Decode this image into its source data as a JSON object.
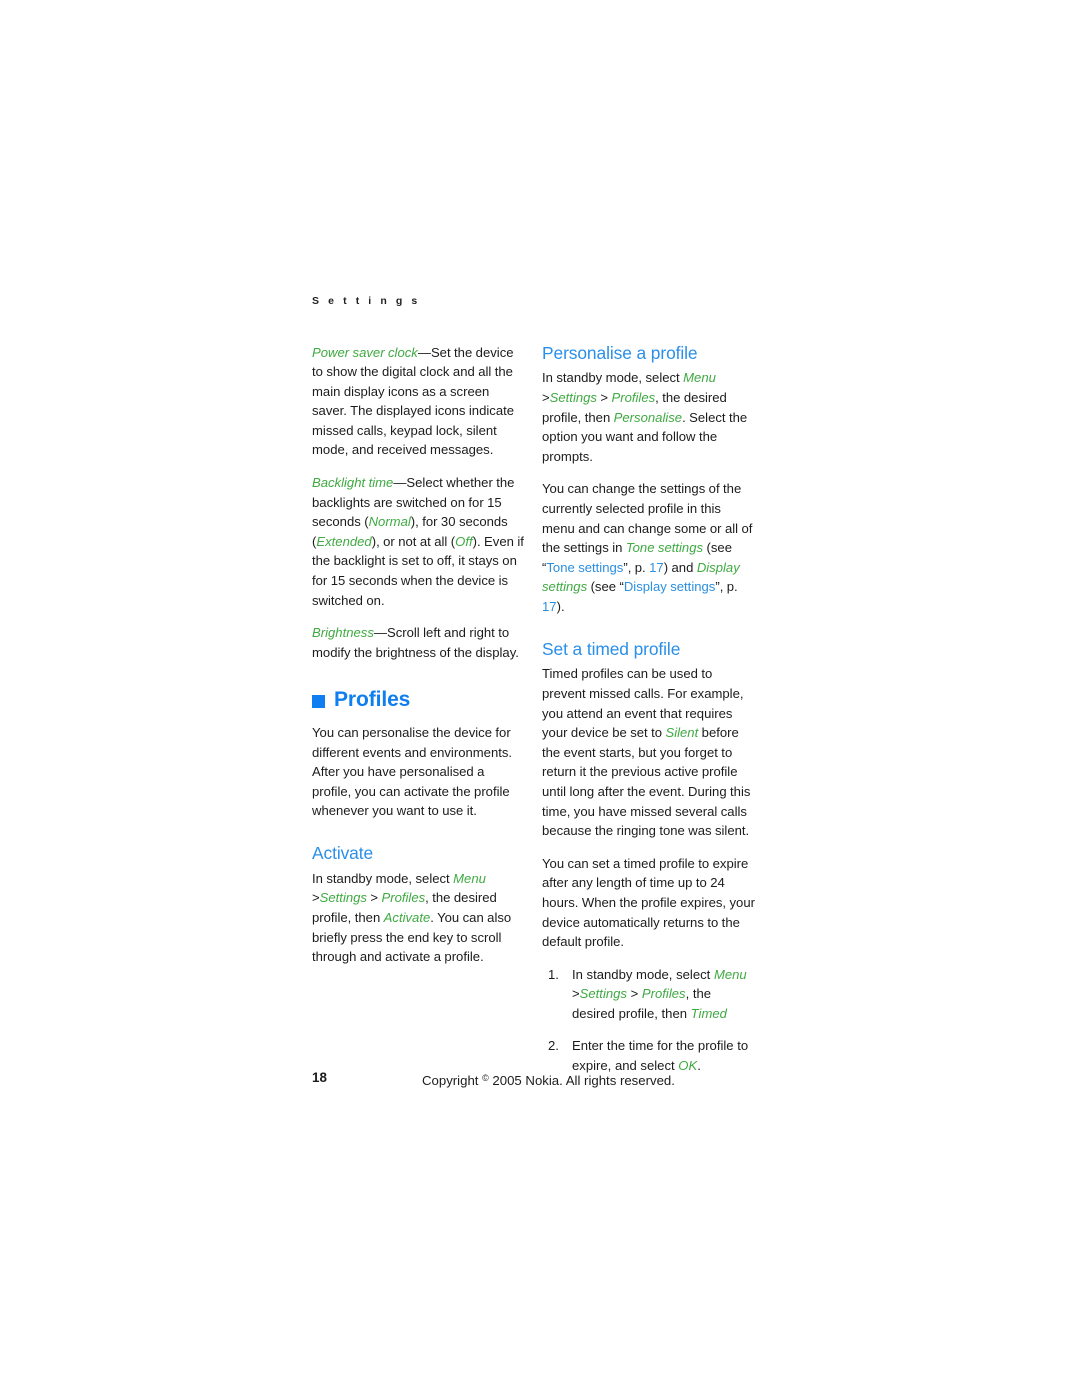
{
  "running_head": "S e t t i n g s",
  "colors": {
    "chapter_blue": "#0f7ef0",
    "section_blue": "#2a8fe8",
    "menu_green": "#3faa42",
    "link_blue": "#2b8fe0",
    "body_text": "#1c1c1c",
    "page_background": "#ffffff"
  },
  "left_column": {
    "power_saver": {
      "term": "Power saver clock",
      "dash": "—Set the device to show the digital clock and all the main display icons as a screen saver. The displayed icons indicate missed calls, keypad lock, silent mode, and received messages."
    },
    "backlight": {
      "term": "Backlight time",
      "t1": "—Select whether the backlights are switched on for 15 seconds (",
      "normal": "Normal",
      "t2": "), for 30 seconds (",
      "extended": "Extended",
      "t3": "), or not at all (",
      "off": "Off",
      "t4": "). Even if the backlight is set to off, it stays on for 15 seconds when the device is switched on."
    },
    "brightness": {
      "term": "Brightness",
      "rest": "—Scroll left and right to modify the brightness of the display."
    },
    "profiles_heading": "Profiles",
    "profiles_intro": "You can personalise the device for different events and environments. After you have personalised a profile, you can activate the profile whenever you want to use it.",
    "activate_heading": "Activate",
    "activate": {
      "t1": "In standby mode, select ",
      "menu": "Menu",
      "t2": " >",
      "settings": "Settings",
      "t3": " > ",
      "profiles": "Profiles",
      "t4": ", the desired profile, then ",
      "activate": "Activate",
      "t5": ". You can also briefly press the end key to scroll through and activate a profile."
    }
  },
  "right_column": {
    "personalise_heading": "Personalise a profile",
    "personalise": {
      "t1": "In standby mode, select ",
      "menu": "Menu",
      "t2": " >",
      "settings": "Settings",
      "t3": " > ",
      "profiles": "Profiles",
      "t4": ", the desired profile, then ",
      "personalise": "Personalise",
      "t5": ". Select the option you want and follow the prompts."
    },
    "change_settings": {
      "t1": "You can change the settings of the currently selected profile in this menu and can change some or all of the settings in ",
      "tone_settings_italic": "Tone settings",
      "t2": " (see “",
      "tone_settings_link": "Tone settings",
      "t3": "”, p. ",
      "page_17a": "17",
      "t4": ") and ",
      "display_settings_italic": "Display settings",
      "t5": " (see “",
      "display_settings_link": "Display settings",
      "t6": "”, p. ",
      "page_17b": "17",
      "t7": ")."
    },
    "timed_heading": "Set a timed profile",
    "timed_p1": {
      "t1": "Timed profiles can be used to prevent missed calls. For example, you attend an event that requires your device be set to ",
      "silent": "Silent",
      "t2": " before the event starts, but you forget to return it the previous active profile until long after the event. During this time, you have missed several calls because the ringing tone was silent."
    },
    "timed_p2": "You can set a timed profile to expire after any length of time up to 24 hours. When the profile expires, your device automatically returns to the default profile.",
    "steps": [
      {
        "number": "1.",
        "t1": "In standby mode, select ",
        "menu": "Menu",
        "t2": " >",
        "settings": "Settings",
        "t3": " > ",
        "profiles": "Profiles",
        "t4": ", the desired profile, then ",
        "timed": "Timed"
      },
      {
        "number": "2.",
        "t1": "Enter the time for the profile to expire, and select ",
        "ok": "OK",
        "t2": "."
      }
    ]
  },
  "footer": {
    "page_number": "18",
    "copyright_pre": "Copyright ",
    "copyright_symbol": "©",
    "copyright_post": " 2005 Nokia. All rights reserved."
  }
}
